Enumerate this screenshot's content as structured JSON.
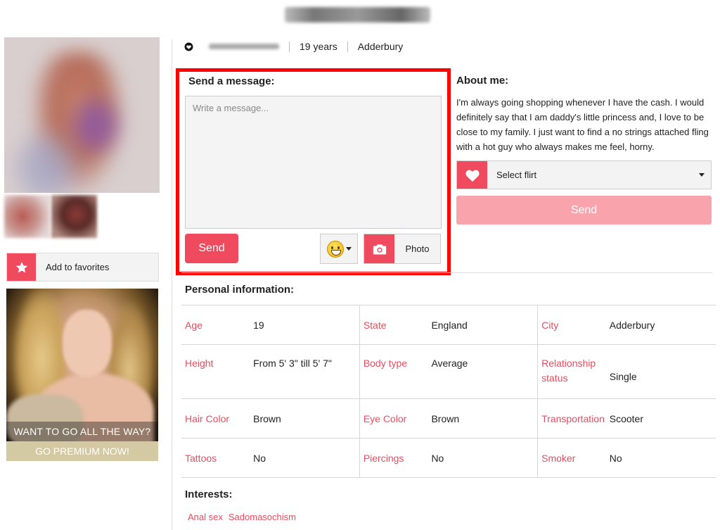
{
  "profile": {
    "age_text": "19 years",
    "location": "Adderbury"
  },
  "message": {
    "title": "Send a message:",
    "placeholder": "Write a message...",
    "send_label": "Send",
    "photo_label": "Photo"
  },
  "sidebar": {
    "favorites_label": "Add to favorites",
    "promo_caption": "WANT TO GO ALL THE WAY?",
    "promo_cta": "GO PREMIUM NOW!"
  },
  "about": {
    "title": "About me:",
    "text": "I'm always going shopping whenever I have the cash. I would definitely say that I am daddy's little princess and, I love to be close to my family. I just want to find a no strings attached fling with a hot guy who always makes me feel, horny.",
    "flirt_select": "Select flirt",
    "send_label": "Send"
  },
  "personal": {
    "title": "Personal information:",
    "rows": [
      [
        {
          "label": "Age",
          "value": "19"
        },
        {
          "label": "State",
          "value": "England"
        },
        {
          "label": "City",
          "value": "Adderbury"
        }
      ],
      [
        {
          "label": "Height",
          "value": "From 5' 3\" till 5' 7\""
        },
        {
          "label": "Body type",
          "value": "Average"
        },
        {
          "label": "Relationship status",
          "value": "Single"
        }
      ],
      [
        {
          "label": "Hair Color",
          "value": "Brown"
        },
        {
          "label": "Eye Color",
          "value": "Brown"
        },
        {
          "label": "Transportation",
          "value": "Scooter"
        }
      ],
      [
        {
          "label": "Tattoos",
          "value": "No"
        },
        {
          "label": "Piercings",
          "value": "No"
        },
        {
          "label": "Smoker",
          "value": "No"
        }
      ]
    ]
  },
  "interests": {
    "title": "Interests:",
    "tags": [
      "Anal sex",
      "Sadomasochism"
    ]
  },
  "colors": {
    "accent": "#f04a5e",
    "accent_light": "#f9a3ac",
    "label_red": "#e84c5e",
    "highlight_border": "#ff0000",
    "promo_gold": "#d3c9a3"
  },
  "icons": {
    "online": "heart-outline-icon",
    "favorites": "star-icon",
    "emoji": "grinning-face-icon",
    "photo": "camera-icon",
    "flirt": "heart-icon"
  }
}
